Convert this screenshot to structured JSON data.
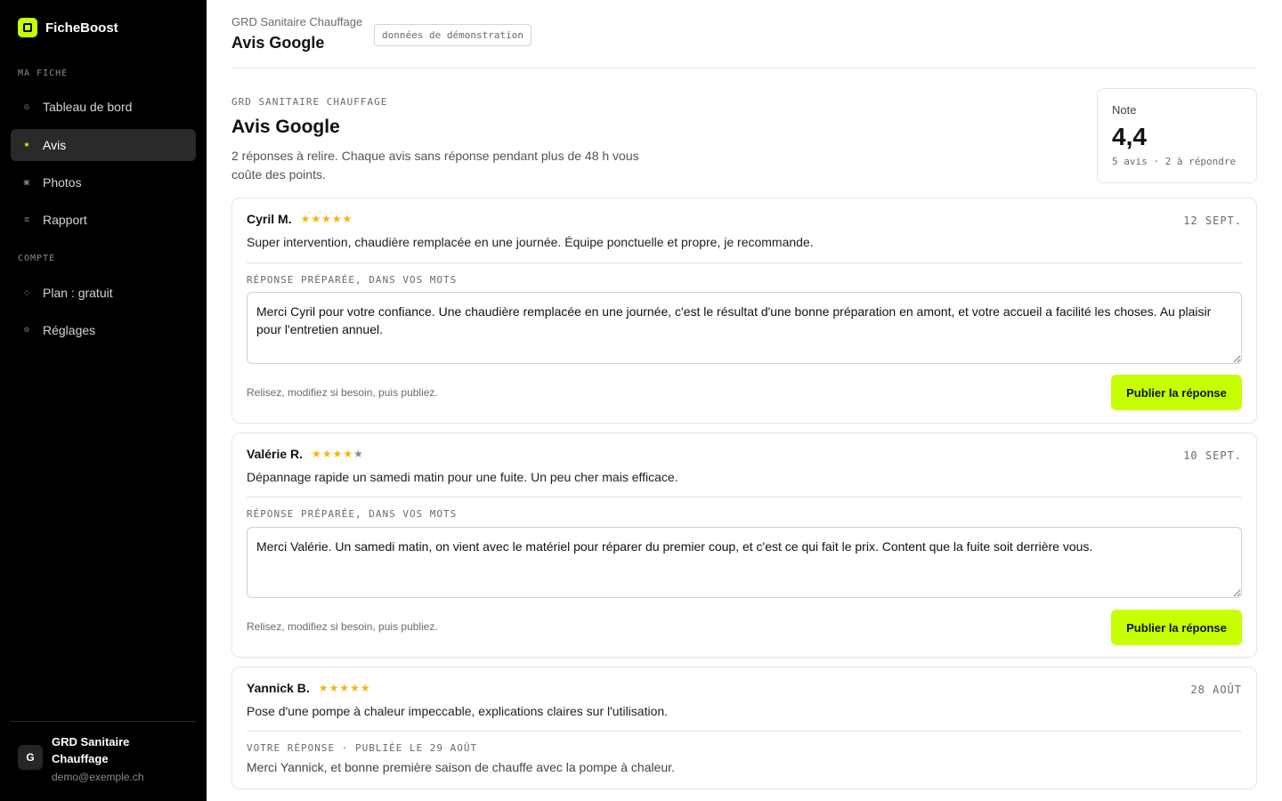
{
  "app": {
    "name": "FicheBoost"
  },
  "sidebar": {
    "section_fiche": "MA FICHE",
    "section_compte": "COMPTE",
    "items": [
      {
        "label": "Tableau de bord",
        "icon": "dashboard-icon",
        "glyph": "◎"
      },
      {
        "label": "Avis",
        "icon": "star-icon",
        "glyph": "★"
      },
      {
        "label": "Photos",
        "icon": "photo-icon",
        "glyph": "▣"
      },
      {
        "label": "Rapport",
        "icon": "report-icon",
        "glyph": "≣"
      },
      {
        "label": "Plan : gratuit",
        "icon": "plan-icon",
        "glyph": "◇"
      },
      {
        "label": "Réglages",
        "icon": "settings-icon",
        "glyph": "⚙"
      }
    ],
    "active_item": "Avis",
    "account": {
      "initial": "G",
      "name": "GRD Sanitaire Chauffage",
      "email": "demo@exemple.ch"
    }
  },
  "header": {
    "business": "GRD Sanitaire Chauffage",
    "title": "Avis Google",
    "demo_badge": "données de démonstration"
  },
  "page": {
    "eyebrow": "GRD SANITAIRE CHAUFFAGE",
    "title": "Avis Google",
    "description": "2 réponses à relire. Chaque avis sans réponse pendant plus de 48 h vous coûte des points."
  },
  "rating": {
    "label": "Note",
    "value": "4,4",
    "meta": "5 avis · 2 à répondre"
  },
  "reviews": [
    {
      "author": "Cyril M.",
      "stars": 5,
      "date": "12 SEPT.",
      "text": "Super intervention, chaudière remplacée en une journée. Équipe ponctuelle et propre, je recommande.",
      "reply_label": "RÉPONSE PRÉPARÉE, DANS VOS MOTS",
      "reply": "Merci Cyril pour votre confiance. Une chaudière remplacée en une journée, c'est le résultat d'une bonne préparation en amont, et votre accueil a facilité les choses. Au plaisir pour l'entretien annuel.",
      "hint": "Relisez, modifiez si besoin, puis publiez.",
      "button": "Publier la réponse"
    },
    {
      "author": "Valérie R.",
      "stars": 4,
      "date": "10 SEPT.",
      "text": "Dépannage rapide un samedi matin pour une fuite. Un peu cher mais efficace.",
      "reply_label": "RÉPONSE PRÉPARÉE, DANS VOS MOTS",
      "reply": "Merci Valérie. Un samedi matin, on vient avec le matériel pour réparer du premier coup, et c'est ce qui fait le prix. Content que la fuite soit derrière vous.",
      "hint": "Relisez, modifiez si besoin, puis publiez.",
      "button": "Publier la réponse"
    },
    {
      "author": "Yannick B.",
      "stars": 5,
      "date": "28 AOÛT",
      "text": "Pose d'une pompe à chaleur impeccable, explications claires sur l'utilisation.",
      "reply_label": "VOTRE RÉPONSE · PUBLIÉE LE 29 AOÛT",
      "reply": "Merci Yannick, et bonne première saison de chauffe avec la pompe à chaleur."
    }
  ],
  "colors": {
    "accent": "#c6ff00",
    "star": "#f5b50a",
    "sidebar_bg": "#000000"
  }
}
